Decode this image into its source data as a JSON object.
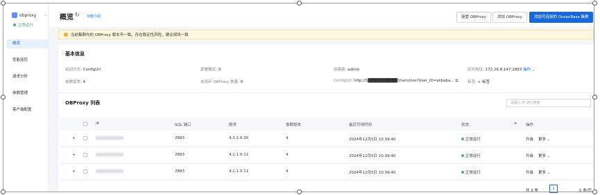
{
  "sidebar": {
    "app_name": "obproxy",
    "status": "正常运行",
    "nav": [
      {
        "label": "概览",
        "active": true
      },
      {
        "label": "性能监控",
        "active": false
      },
      {
        "label": "请求分析",
        "active": false
      },
      {
        "label": "参数管理",
        "active": false
      },
      {
        "label": "客户端配置",
        "active": false
      }
    ]
  },
  "header": {
    "title": "概览",
    "intro_link": "功能介绍",
    "buttons": {
      "takeover": "接管 OBProxy",
      "add": "添加 OBProxy",
      "add_cluster": "添加可连接的 OceanBase 集群"
    }
  },
  "alert": {
    "text": "当前集群内的 OBProxy 版本不一致，存在稳定性风险，建议保持一致"
  },
  "basic_info": {
    "title": "基本信息",
    "start_mode_label": "启动方式:",
    "start_mode_value": "ConfigUrl",
    "deploy_mode_label": "部署模式:",
    "deploy_mode_value": "3",
    "creator_label": "创建者:",
    "creator_value": "admin",
    "access_label": "访问地址:",
    "access_value": "172.26.8.147:2883",
    "action_label": "操作",
    "param_version_label": "参数版本:",
    "param_version_value": "4",
    "unsynced_label": "未同步 OBProxy 数量:",
    "unsynced_value": "0",
    "configurl_label": "ConfigUrl:",
    "configurl_value": "http://1██████████0/services?User_ID=alibaba...",
    "tag_label": "标签:",
    "tag_add": "+ 标签"
  },
  "proxy_list": {
    "title": "OBProxy 列表",
    "search_placeholder": "请输入 IP 进行搜索",
    "columns": [
      "IP",
      "SQL 端口",
      "版本",
      "参数版本",
      "最近可用时间",
      "状态",
      "操作"
    ],
    "rows": [
      {
        "port": "2883",
        "version": "4.3.2.0-26",
        "param_version": "4",
        "last_time": "2024年12月5日 10:39:40",
        "status": "正常运行",
        "upgrade": "升级",
        "more": "更多"
      },
      {
        "port": "2883",
        "version": "4.2.1.0-11",
        "param_version": "4",
        "last_time": "2024年12月5日 10:39:40",
        "status": "正常运行",
        "upgrade": "升级",
        "more": "更多"
      },
      {
        "port": "2883",
        "version": "4.2.1.0-11",
        "param_version": "4",
        "last_time": "2024年12月5日 10:39:40",
        "status": "正常运行",
        "upgrade": "升级",
        "more": "更多"
      }
    ],
    "pagination": {
      "total": "共 3 条",
      "page": "1",
      "page_size": "5 条/页"
    }
  },
  "colors": {
    "accent": "#1668dc",
    "success": "#4cb46b",
    "warning": "#f5a623"
  }
}
